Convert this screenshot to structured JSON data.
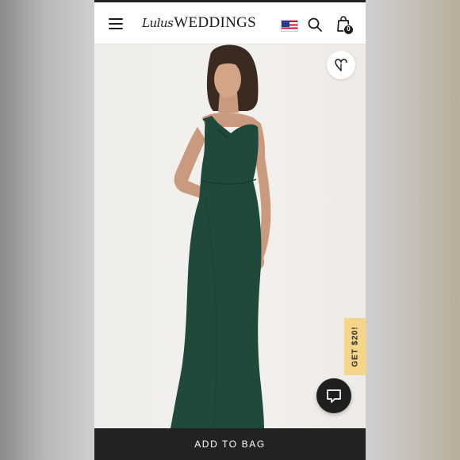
{
  "header": {
    "logo_script": "Lulus",
    "logo_main": "WEDDINGS",
    "cart_count": "0",
    "icons": {
      "menu": "hamburger-menu-icon",
      "region": "us-flag-icon",
      "search": "search-icon",
      "bag": "shopping-bag-icon"
    }
  },
  "product": {
    "image_subject": "dark green one-shoulder maxi dress",
    "colors": {
      "dress": "#1f4a3b",
      "backdrop": "#f1efeb"
    },
    "wishlist_icon": "heart-outline-icon"
  },
  "promo": {
    "label": "GET $20!",
    "color": "#f4d58a"
  },
  "chat": {
    "icon": "chat-bubble-icon"
  },
  "cta": {
    "label": "ADD TO BAG"
  }
}
